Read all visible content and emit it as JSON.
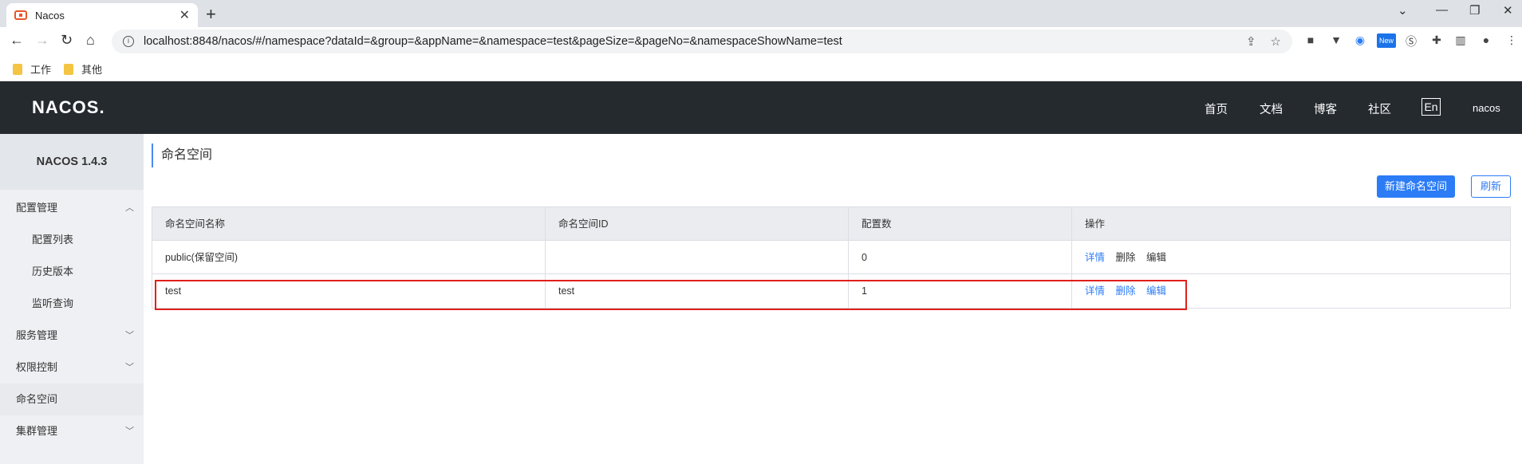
{
  "browser": {
    "tab_title": "Nacos",
    "tab_close": "✕",
    "new_tab": "+",
    "url": "localhost:8848/nacos/#/namespace?dataId=&group=&appName=&namespace=test&pageSize=&pageNo=&namespaceShowName=test",
    "bookmarks": [
      "工作",
      "其他"
    ],
    "ext_new_badge": "New"
  },
  "header": {
    "logo": "NACOS.",
    "nav": [
      "首页",
      "文档",
      "博客",
      "社区"
    ],
    "lang": "En",
    "user": "nacos"
  },
  "sidebar": {
    "version": "NACOS 1.4.3",
    "items": [
      {
        "label": "配置管理",
        "level": "top"
      },
      {
        "label": "配置列表",
        "level": "sub"
      },
      {
        "label": "历史版本",
        "level": "sub"
      },
      {
        "label": "监听查询",
        "level": "sub"
      },
      {
        "label": "服务管理",
        "level": "top"
      },
      {
        "label": "权限控制",
        "level": "top"
      },
      {
        "label": "命名空间",
        "level": "top",
        "active": true
      },
      {
        "label": "集群管理",
        "level": "top"
      }
    ]
  },
  "main": {
    "title": "命名空间",
    "create_button": "新建命名空间",
    "refresh_button": "刷新",
    "columns": [
      "命名空间名称",
      "命名空间ID",
      "配置数",
      "操作"
    ],
    "rows": [
      {
        "name": "public(保留空间)",
        "id": "",
        "count": "0",
        "ops": [
          "详情",
          "删除",
          "编辑"
        ]
      },
      {
        "name": "test",
        "id": "test",
        "count": "1",
        "ops": [
          "详情",
          "删除",
          "编辑"
        ]
      }
    ]
  },
  "colors": {
    "header_bg": "#252a2f",
    "accent": "#2c7cf6",
    "highlight_border": "#e0201b"
  }
}
